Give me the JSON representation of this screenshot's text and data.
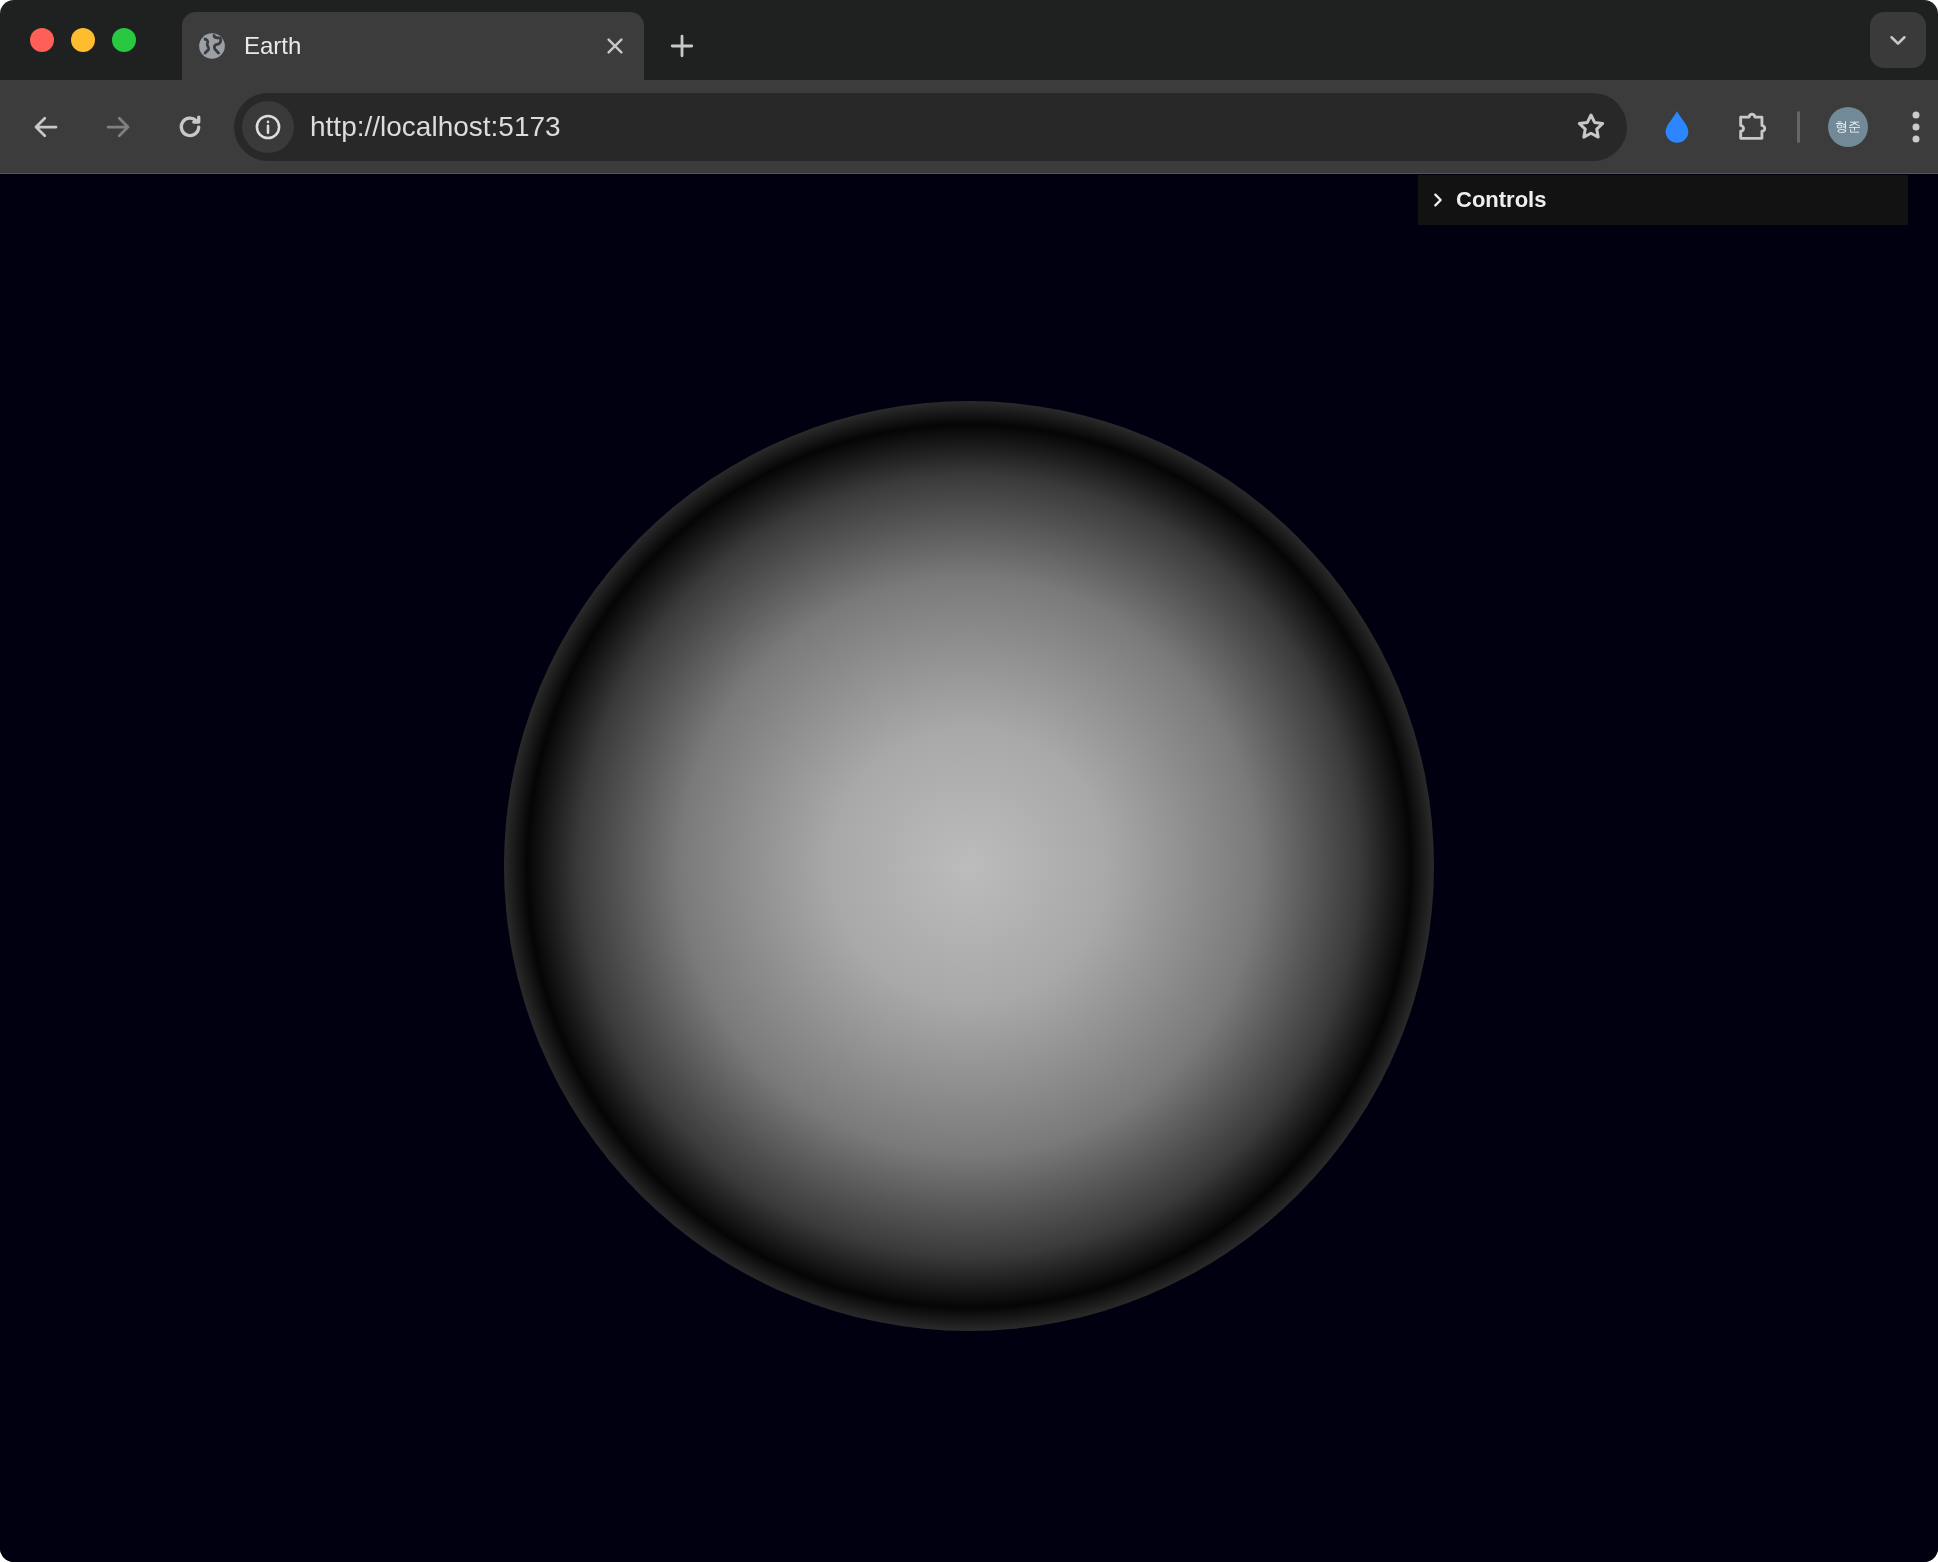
{
  "tab": {
    "title": "Earth",
    "selected": true
  },
  "address_bar": {
    "url": "http://localhost:5173"
  },
  "profile": {
    "initials": "형준"
  },
  "controls_panel": {
    "title": "Controls",
    "expanded": false
  }
}
